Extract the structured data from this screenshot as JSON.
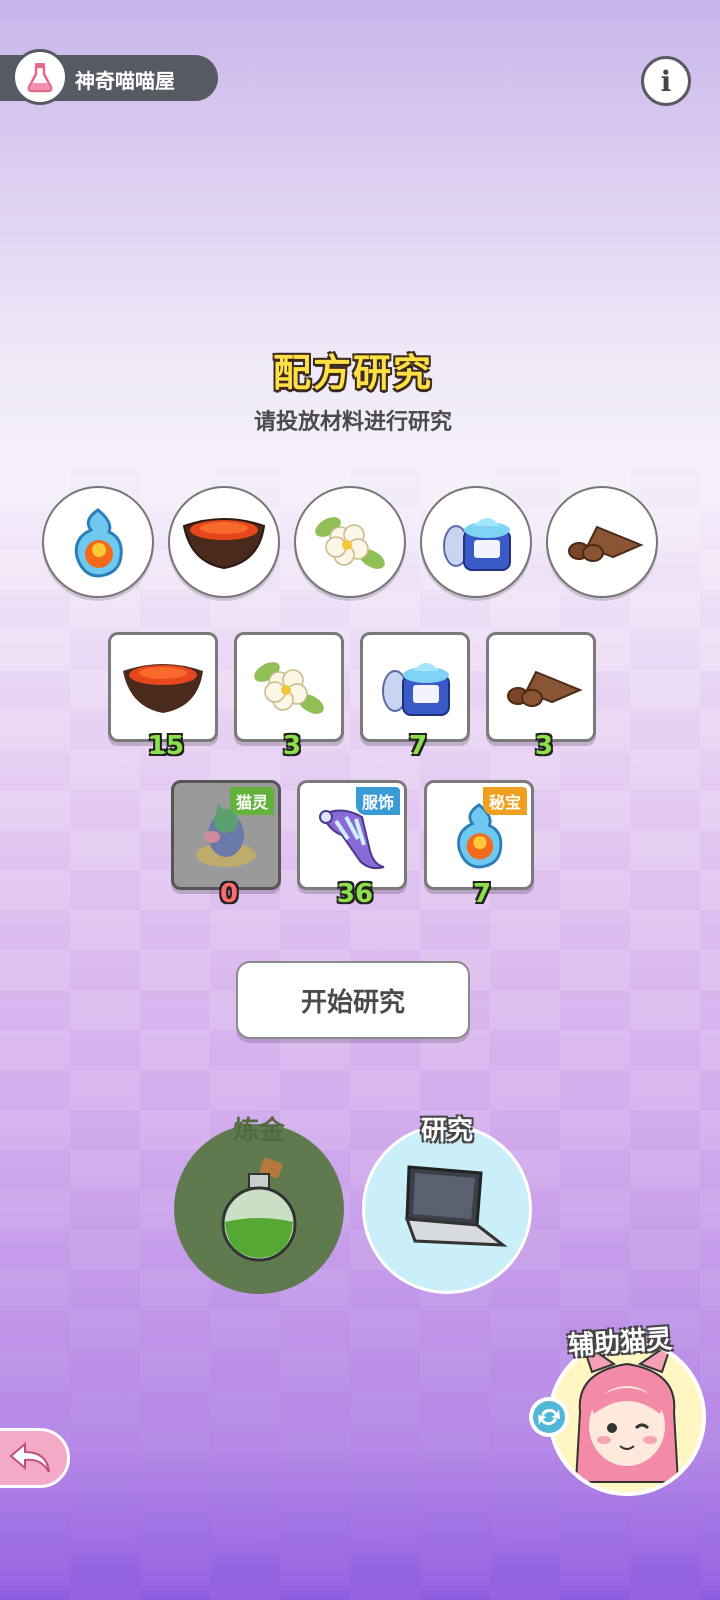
{
  "header": {
    "shop_label": "神奇喵喵屋",
    "info_icon": "info-icon"
  },
  "research": {
    "title": "配方研究",
    "subtitle": "请投放材料进行研究"
  },
  "slots": [
    {
      "icon": "spirit-flame-icon"
    },
    {
      "icon": "red-powder-bowl-icon"
    },
    {
      "icon": "white-flower-icon"
    },
    {
      "icon": "blue-cream-jar-icon"
    },
    {
      "icon": "chocolate-pieces-icon"
    }
  ],
  "materials": [
    {
      "icon": "red-powder-bowl-icon",
      "count": "15"
    },
    {
      "icon": "white-flower-icon",
      "count": "3"
    },
    {
      "icon": "blue-cream-jar-icon",
      "count": "7"
    },
    {
      "icon": "chocolate-pieces-icon",
      "count": "3"
    }
  ],
  "categories": [
    {
      "tag": "猫灵",
      "count": "0",
      "icon": "cat-spirit-icon",
      "tag_color": "#63b33b"
    },
    {
      "tag": "服饰",
      "count": "36",
      "icon": "scarf-icon",
      "tag_color": "#3a9ad6"
    },
    {
      "tag": "秘宝",
      "count": "7",
      "icon": "spirit-flame-icon",
      "tag_color": "#f0a020"
    }
  ],
  "start_button": "开始研究",
  "modes": [
    {
      "label": "炼金",
      "icon": "potion-bottle-icon"
    },
    {
      "label": "研究",
      "icon": "laptop-icon"
    }
  ],
  "helper": {
    "label": "辅助猫灵",
    "icon": "pink-cat-girl-avatar"
  },
  "back_icon": "back-arrow-icon",
  "swap_icon": "swap-icon"
}
